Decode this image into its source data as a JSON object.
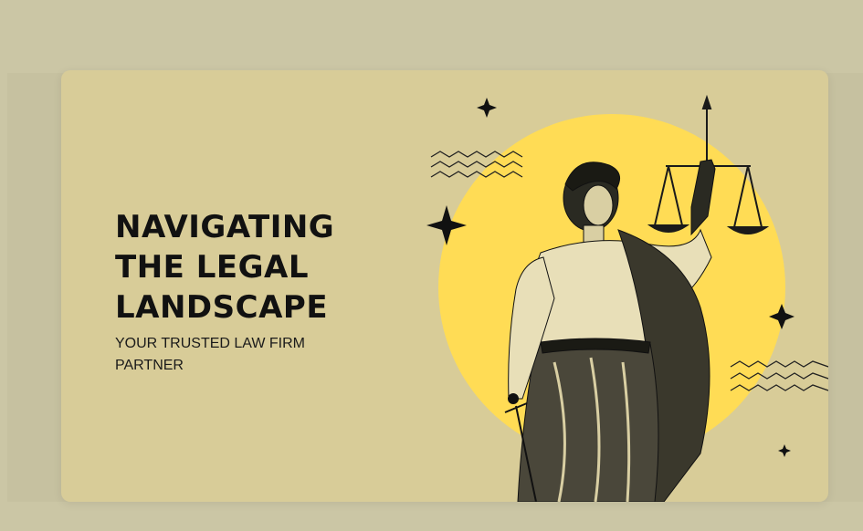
{
  "slide": {
    "headline_lines": [
      "NAVIGATING",
      "THE LEGAL",
      "LANDSCAPE"
    ],
    "tagline": "YOUR TRUSTED LAW FIRM PARTNER"
  },
  "illustration": {
    "subject": "lady-justice-engraving",
    "icons": [
      "sparkle-icon",
      "zigzag-lines-icon",
      "scales-icon",
      "sword-icon"
    ]
  },
  "colors": {
    "backdrop": "#cbc6a5",
    "card": "#d8cc98",
    "sun": "#ffdc55",
    "ink": "#111111"
  }
}
